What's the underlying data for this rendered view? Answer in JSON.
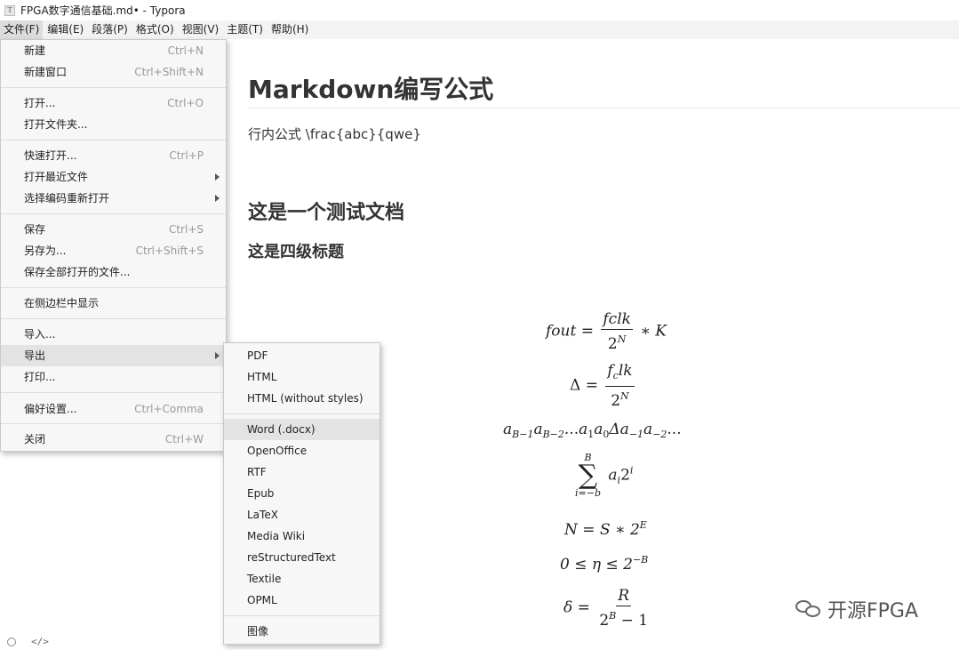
{
  "window": {
    "title": "FPGA数字通信基础.md• - Typora",
    "icon": "typora-app-icon"
  },
  "menubar": [
    {
      "label": "文件(F)",
      "active": true
    },
    {
      "label": "编辑(E)"
    },
    {
      "label": "段落(P)"
    },
    {
      "label": "格式(O)"
    },
    {
      "label": "视图(V)"
    },
    {
      "label": "主题(T)"
    },
    {
      "label": "帮助(H)"
    }
  ],
  "file_menu": {
    "items": [
      {
        "label": "新建",
        "shortcut": "Ctrl+N"
      },
      {
        "label": "新建窗口",
        "shortcut": "Ctrl+Shift+N"
      },
      {
        "label": "打开...",
        "shortcut": "Ctrl+O"
      },
      {
        "label": "打开文件夹...",
        "shortcut": ""
      },
      {
        "label": "快速打开...",
        "shortcut": "Ctrl+P"
      },
      {
        "label": "打开最近文件",
        "shortcut": ""
      },
      {
        "label": "选择编码重新打开",
        "shortcut": ""
      },
      {
        "label": "保存",
        "shortcut": "Ctrl+S"
      },
      {
        "label": "另存为...",
        "shortcut": "Ctrl+Shift+S"
      },
      {
        "label": "保存全部打开的文件...",
        "shortcut": ""
      },
      {
        "label": "在侧边栏中显示",
        "shortcut": ""
      },
      {
        "label": "导入...",
        "shortcut": ""
      },
      {
        "label": "导出",
        "shortcut": ""
      },
      {
        "label": "打印...",
        "shortcut": ""
      },
      {
        "label": "偏好设置...",
        "shortcut": "Ctrl+Comma"
      },
      {
        "label": "关闭",
        "shortcut": "Ctrl+W"
      }
    ]
  },
  "export_menu": {
    "items": [
      {
        "label": "PDF"
      },
      {
        "label": "HTML"
      },
      {
        "label": "HTML (without styles)"
      },
      {
        "label": "Word (.docx)"
      },
      {
        "label": "OpenOffice"
      },
      {
        "label": "RTF"
      },
      {
        "label": "Epub"
      },
      {
        "label": "LaTeX"
      },
      {
        "label": "Media Wiki"
      },
      {
        "label": "reStructuredText"
      },
      {
        "label": "Textile"
      },
      {
        "label": "OPML"
      },
      {
        "label": "图像"
      }
    ]
  },
  "document": {
    "h1": "Markdown编写公式",
    "inline_para": "行内公式 \\frac{abc}{qwe}",
    "h2": "这是一个测试文档",
    "h4": "这是四级标题",
    "math": {
      "f1": {
        "lhs": "fout",
        "eq": "=",
        "num": "fclk",
        "den_base": "2",
        "den_exp": "N",
        "rest": "∗ K"
      },
      "f2": {
        "lhs": "Δ",
        "eq": "=",
        "num_a": "f",
        "num_sub": "c",
        "num_b": "lk",
        "den_base": "2",
        "den_exp": "N"
      },
      "f3": {
        "text_a": "a",
        "sub1": "B−1",
        "sub2": "B−2",
        "mid": "...",
        "sub3": "1",
        "sub4": "0",
        "delta": "Δa",
        "sub5": "−1",
        "sub6": "−2",
        "tail": "..."
      },
      "f4": {
        "upper": "B",
        "lower": "i=−b",
        "body_a": "a",
        "body_sub": "i",
        "body_base": "2",
        "body_exp": "i"
      },
      "f5": {
        "lhs": "N",
        "eq": "=",
        "rhs": "S ∗ 2",
        "exp": "E"
      },
      "f6": {
        "text": "0 ≤ η ≤ 2",
        "exp": "−B"
      },
      "f7": {
        "lhs": "δ",
        "eq": "=",
        "num": "R",
        "den_base": "2",
        "den_exp": "B",
        "den_rest": " − 1"
      }
    }
  },
  "statusbar": {
    "code_toggle": "</>"
  },
  "watermark": {
    "text": "开源FPGA"
  }
}
